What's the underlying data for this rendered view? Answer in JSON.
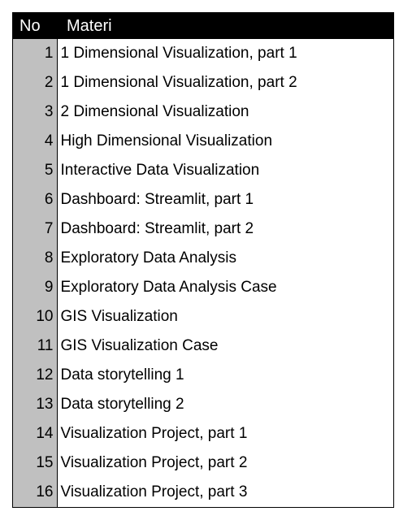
{
  "header": {
    "no": "No",
    "materi": "Materi"
  },
  "rows": [
    {
      "no": "1",
      "materi": "1 Dimensional Visualization, part 1"
    },
    {
      "no": "2",
      "materi": "1 Dimensional Visualization, part 2"
    },
    {
      "no": "3",
      "materi": "2 Dimensional Visualization"
    },
    {
      "no": "4",
      "materi": "High Dimensional Visualization"
    },
    {
      "no": "5",
      "materi": "Interactive Data Visualization"
    },
    {
      "no": "6",
      "materi": "Dashboard: Streamlit, part 1"
    },
    {
      "no": "7",
      "materi": "Dashboard: Streamlit, part 2"
    },
    {
      "no": "8",
      "materi": "Exploratory Data Analysis"
    },
    {
      "no": "9",
      "materi": "Exploratory Data Analysis Case"
    },
    {
      "no": "10",
      "materi": "GIS Visualization"
    },
    {
      "no": "11",
      "materi": "GIS Visualization Case"
    },
    {
      "no": "12",
      "materi": "Data storytelling 1"
    },
    {
      "no": "13",
      "materi": "Data storytelling 2"
    },
    {
      "no": "14",
      "materi": "Visualization Project, part 1"
    },
    {
      "no": "15",
      "materi": "Visualization Project, part 2"
    },
    {
      "no": "16",
      "materi": "Visualization Project, part 3"
    }
  ]
}
